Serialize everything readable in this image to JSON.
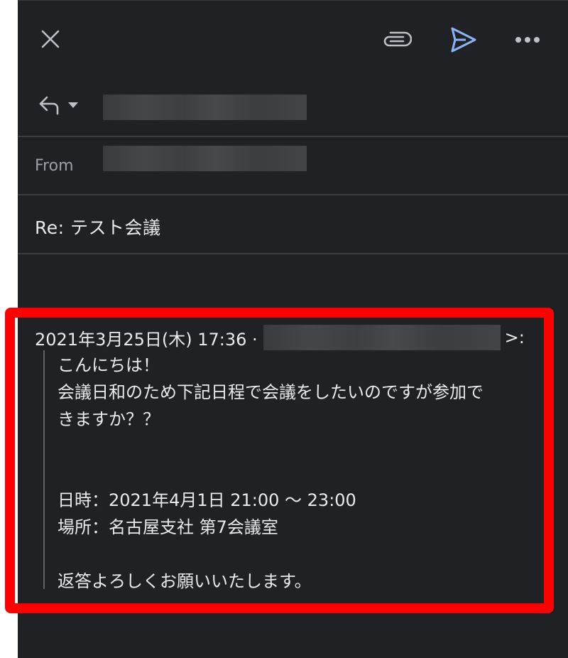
{
  "toolbar": {
    "close_icon": "close-icon",
    "attach_icon": "paperclip-icon",
    "send_icon": "send-icon",
    "more_icon": "more-horizontal-icon",
    "send_color": "#8ab4f8"
  },
  "reply": {
    "reply_icon": "reply-icon",
    "dropdown_icon": "caret-down-icon",
    "to_value": "[redacted]"
  },
  "from": {
    "label": "From",
    "value": "[redacted]"
  },
  "subject": {
    "value": "Re: テスト会議"
  },
  "quoted": {
    "header_prefix": "2021年3月25日(木) 17:36 ·",
    "sender": "[redacted]",
    "header_suffix": ">:",
    "lines": [
      "こんにちは！",
      "会議日和のため下記日程で会議をしたいのですが参加で",
      "きますか？？",
      "",
      "",
      "日時：2021年4月1日 21:00 〜 23:00",
      "場所：名古屋支社 第7会議室",
      "",
      "返答よろしくお願いいたします。"
    ]
  },
  "annotation": {
    "highlight_color": "#ff0000"
  }
}
